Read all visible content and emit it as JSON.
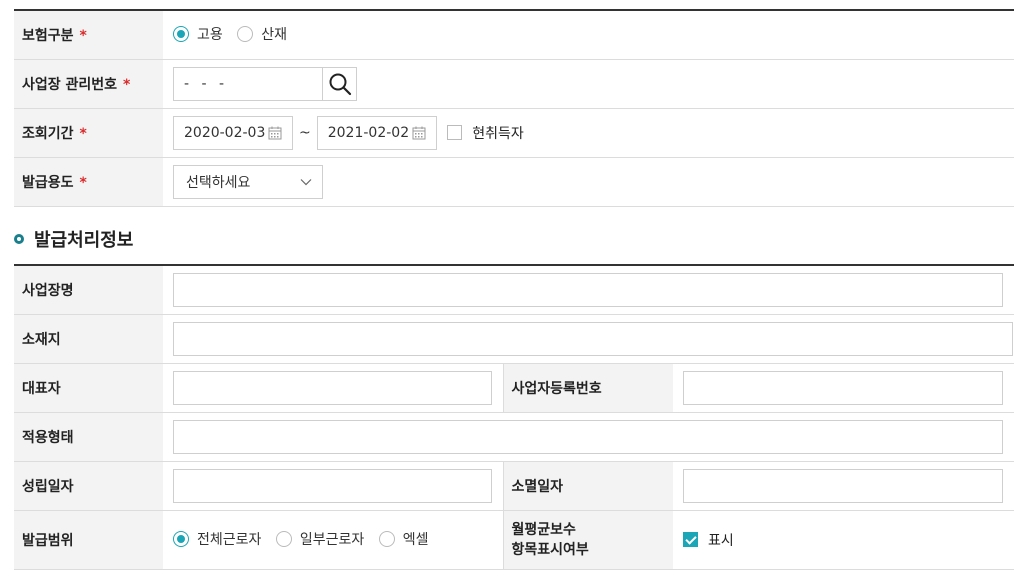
{
  "search_form": {
    "insurance_type": {
      "label": "보험구분",
      "required_mark": "*",
      "options": [
        {
          "label": "고용",
          "selected": true
        },
        {
          "label": "산재",
          "selected": false
        }
      ]
    },
    "biz_mgmt_no": {
      "label": "사업장 관리번호",
      "required_mark": "*",
      "value": "- -  -"
    },
    "period": {
      "label": "조회기간",
      "required_mark": "*",
      "start": "2020-02-03",
      "separator": "~",
      "end": "2021-02-02",
      "current_employee_label": "현취득자",
      "current_employee_checked": false
    },
    "purpose": {
      "label": "발급용도",
      "required_mark": "*",
      "selected": "선택하세요"
    }
  },
  "section": {
    "title": "발급처리정보"
  },
  "issue_info": {
    "biz_name_label": "사업장명",
    "biz_name_value": "",
    "location_label": "소재지",
    "location_value": "",
    "representative_label": "대표자",
    "representative_value": "",
    "biz_reg_no_label": "사업자등록번호",
    "biz_reg_no_value": "",
    "applied_type_label": "적용형태",
    "applied_type_value": "",
    "established_label": "성립일자",
    "established_value": "",
    "extinguished_label": "소멸일자",
    "extinguished_value": "",
    "scope_label": "발급범위",
    "scope_options": [
      {
        "label": "전체근로자",
        "selected": true
      },
      {
        "label": "일부근로자",
        "selected": false
      },
      {
        "label": "엑셀",
        "selected": false
      }
    ],
    "avg_pay_label_line1": "월평균보수",
    "avg_pay_label_line2": "항목표시여부",
    "display_label": "표시",
    "display_checked": true
  },
  "colors": {
    "accent": "#1aa6b7",
    "required": "#d92b2b",
    "header_bg": "#f3f3f3"
  },
  "icons": {
    "search": "search-icon",
    "calendar": "calendar-icon",
    "dropdown": "chevron-down-icon",
    "bullet": "section-bullet-icon"
  }
}
